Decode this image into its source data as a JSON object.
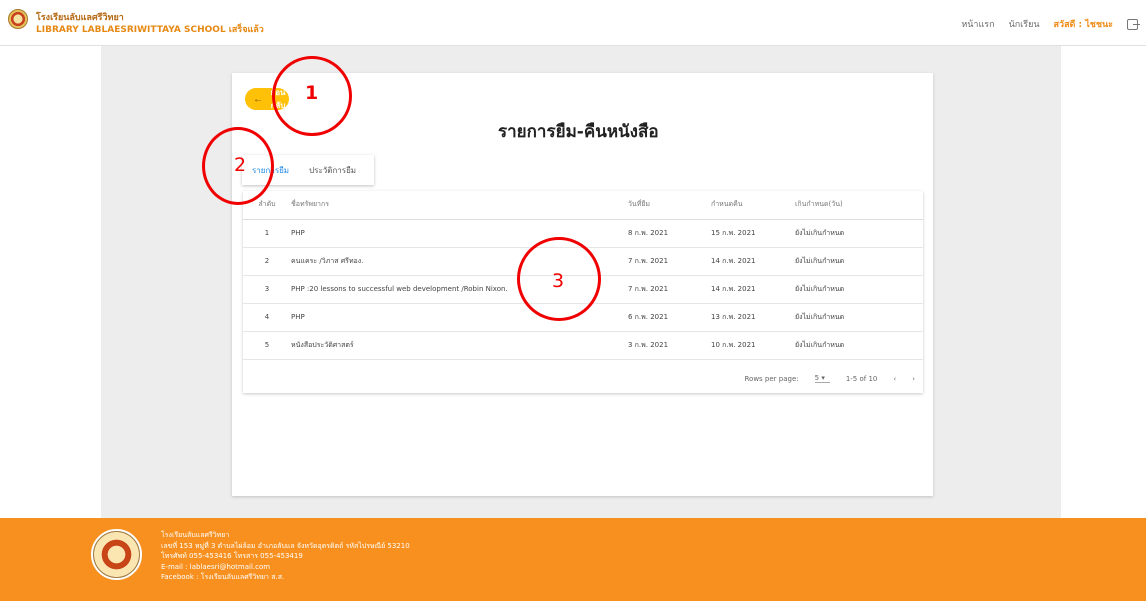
{
  "header": {
    "school_name_th": "โรงเรียนลับแลศรีวิทยา",
    "school_name_en": "LIBRARY LABLAESRIWITTAYA SCHOOL เสร็จแล้ว",
    "nav_home": "หน้าแรก",
    "nav_student": "นักเรียน",
    "user_label": "สวัสดี : ไชชนะ",
    "logout_icon": "logout-icon"
  },
  "page": {
    "back_label": "ย้อนกลับ",
    "title": "รายการยืม-คืนหนังสือ",
    "tabs": [
      "รายการยืม",
      "ประวัติการยืม"
    ],
    "annotations": [
      "1",
      "2",
      "3"
    ]
  },
  "table": {
    "headers": [
      "ลำดับ",
      "ชื่อทรัพยากร",
      "วันที่ยืม",
      "กำหนดคืน",
      "เกินกำหนด(วัน)"
    ],
    "rows": [
      [
        "1",
        "PHP",
        "8 ก.พ. 2021",
        "15 ก.พ. 2021",
        "ยังไม่เกินกำหนด"
      ],
      [
        "2",
        "คนแคระ /วิภาส ศรีทอง.",
        "7 ก.พ. 2021",
        "14 ก.พ. 2021",
        "ยังไม่เกินกำหนด"
      ],
      [
        "3",
        "PHP :20 lessons to successful web development /Robin Nixon.",
        "7 ก.พ. 2021",
        "14 ก.พ. 2021",
        "ยังไม่เกินกำหนด"
      ],
      [
        "4",
        "PHP",
        "6 ก.พ. 2021",
        "13 ก.พ. 2021",
        "ยังไม่เกินกำหนด"
      ],
      [
        "5",
        "หนังสือประวัติศาสตร์",
        "3 ก.พ. 2021",
        "10 ก.พ. 2021",
        "ยังไม่เกินกำหนด"
      ]
    ],
    "rows_per_page_label": "Rows per page:",
    "rows_per_page_value": "5",
    "range_text": "1-5 of 10"
  },
  "footer": {
    "lines": [
      "โรงเรียนลับแลศรีวิทยา",
      "เลขที่ 153 หมู่ที่ 3 ตำบลไผ่ล้อม อำเภอลับแล จังหวัดอุตรดิตถ์ รหัสไปรษณีย์ 53210",
      "โทรศัพท์ 055-453416 โทรสาร 055-453419",
      "E-mail : lablaesri@hotmail.com",
      "Facebook : โรงเรียนลับแลศรีวิทยา ส.ส."
    ]
  }
}
